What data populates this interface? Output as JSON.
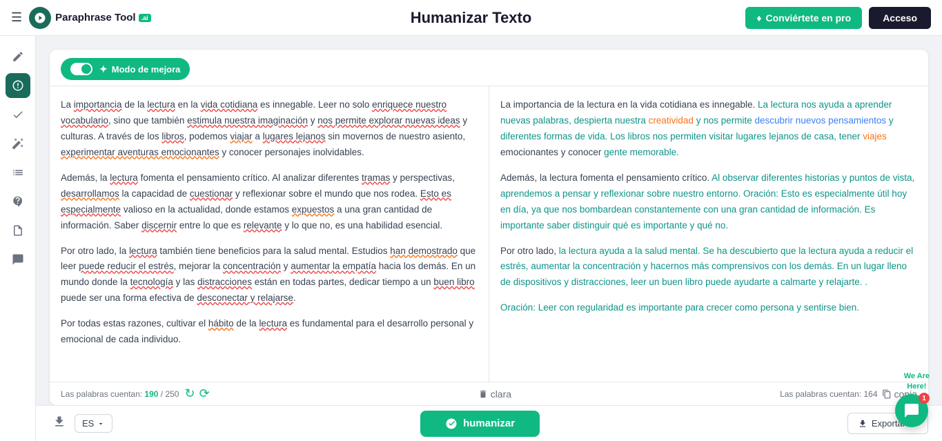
{
  "header": {
    "hamburger": "☰",
    "logo_text": "Paraphrase Tool",
    "logo_badge": ".ai",
    "title": "Humanizar Texto",
    "btn_pro": "Conviértete en pro",
    "btn_acceso": "Acceso"
  },
  "sidebar": {
    "items": [
      {
        "icon": "✏️",
        "name": "edit",
        "active": false
      },
      {
        "icon": "🤖",
        "name": "ai-humanize",
        "active": true
      },
      {
        "icon": "🔍",
        "name": "check",
        "active": false
      },
      {
        "icon": "✨",
        "name": "magic",
        "active": false
      },
      {
        "icon": "📋",
        "name": "list",
        "active": false
      },
      {
        "icon": "🧠",
        "name": "brain",
        "active": false
      },
      {
        "icon": "📄",
        "name": "document",
        "active": false
      },
      {
        "icon": "💬",
        "name": "chat",
        "active": false
      }
    ]
  },
  "toolbar": {
    "modo_label": "Modo de mejora"
  },
  "left_panel": {
    "paragraphs": [
      "La importancia de la lectura en la vida cotidiana es innegable. Leer no solo enriquece nuestro vocabulario, sino que también estimula nuestra imaginación y nos permite explorar nuevas ideas y culturas. A través de los libros, podemos viajar a lugares lejanos sin movernos de nuestro asiento, experimentar aventuras emocionantes y conocer personajes inolvidables.",
      "Además, la lectura fomenta el pensamiento crítico. Al analizar diferentes tramas y perspectivas, desarrollamos la capacidad de cuestionar y reflexionar sobre el mundo que nos rodea. Esto es especialmente valioso en la actualidad, donde estamos expuestos a una gran cantidad de información. Saber discernir entre lo que es relevante y lo que no, es una habilidad esencial.",
      "Por otro lado, la lectura también tiene beneficios para la salud mental. Estudios han demostrado que leer puede reducir el estrés, mejorar la concentración y aumentar la empatía hacia los demás. En un mundo donde la tecnología y las distracciones están en todas partes, dedicar tiempo a un buen libro puede ser una forma efectiva de desconectar y relajarse.",
      "Por todas estas razones, cultivar el hábito de la lectura es fundamental para el desarrollo personal y emocional de cada individuo."
    ],
    "word_count": "Las palabras cuentan: 190 / 250",
    "word_count_number": "190",
    "word_count_limit": "250"
  },
  "right_panel": {
    "paragraphs": [
      "La importancia de la lectura en la vida cotidiana es innegable. La lectura nos ayuda a aprender nuevas palabras, despierta nuestra creatividad y nos permite descubrir nuevos pensamientos y diferentes formas de vida. Los libros nos permiten visitar lugares lejanos de casa, tener viajes emocionantes y conocer gente memorable.",
      "Además, la lectura fomenta el pensamiento crítico. Al observar diferentes historias y puntos de vista, aprendemos a pensar y reflexionar sobre nuestro entorno. Oración: Esto es especialmente útil hoy en día, ya que nos bombardean constantemente con una gran cantidad de información. Es importante saber distinguir qué es importante y qué no.",
      "Por otro lado, la lectura ayuda a la salud mental. Se ha descubierto que la lectura ayuda a reducir el estrés, aumentar la concentración y hacernos más comprensivos con los demás. En un lugar lleno de dispositivos y distracciones, leer un buen libro puede ayudarte a calmarte y relajarte. .",
      "Oración: Leer con regularidad es importante para crecer como persona y sentirse bien."
    ],
    "word_count": "Las palabras cuentan: 164"
  },
  "footer_left": {
    "word_count_label": "Las palabras cuentan: ",
    "word_count_val": "190 / 250",
    "clara_label": "clara"
  },
  "footer_right": {
    "copy_label": "copia"
  },
  "action_bar": {
    "lang": "ES",
    "humanizar_label": "humanizar",
    "exportar_label": "Exportar"
  },
  "chat": {
    "we_are_here": "We Are\nHere!",
    "badge": "1"
  }
}
